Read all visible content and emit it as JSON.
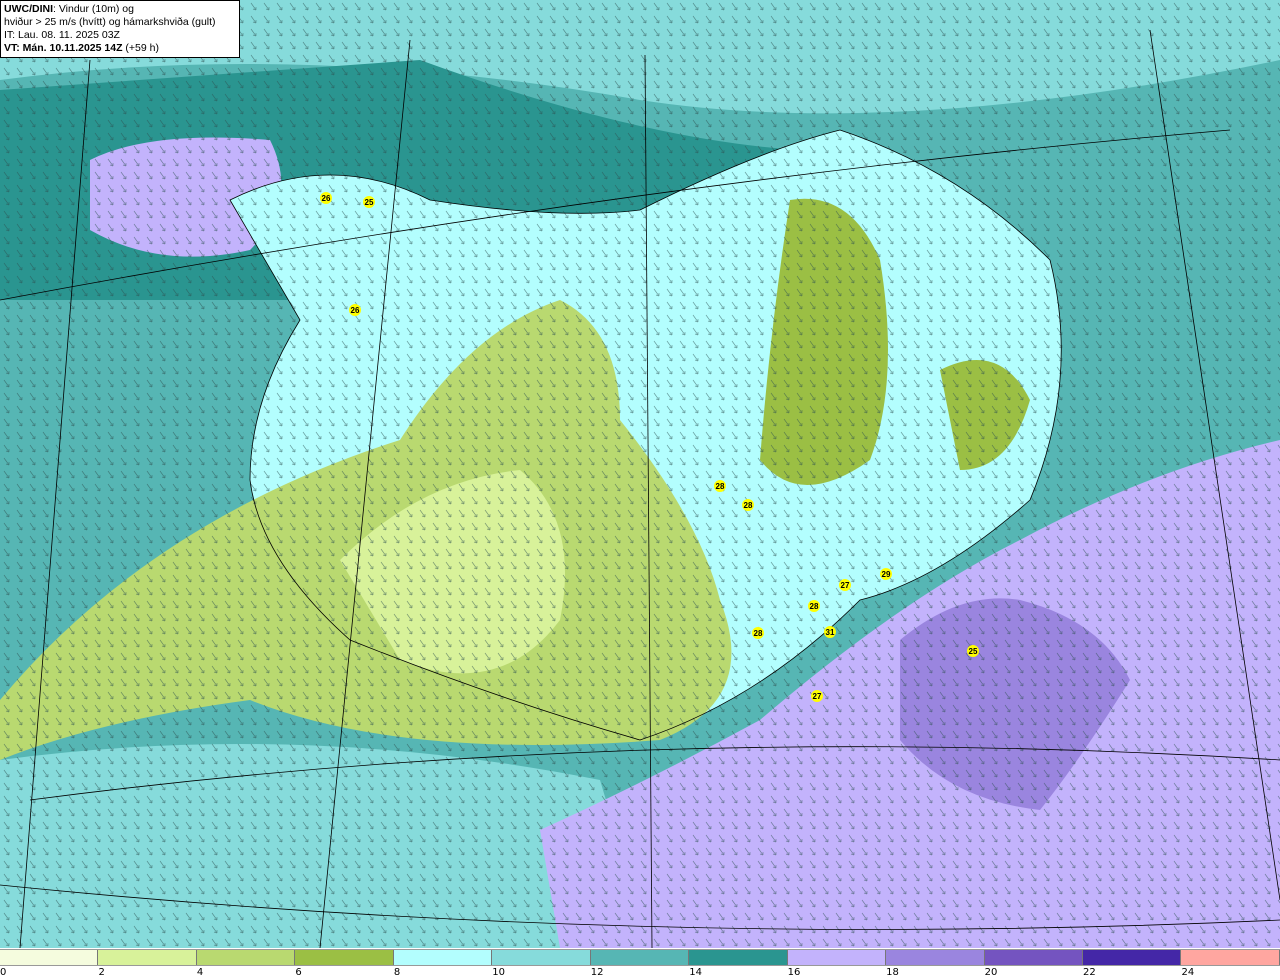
{
  "header": {
    "model": "UWC/DINI",
    "title_rest": ": Vindur (10m) og",
    "line2": "hviður > 25 m/s (hvítt) og hámarkshviða (gult)",
    "it_line": "IT: Lau. 08. 11. 2025 03Z",
    "vt_bold": "VT: Mán. 10.11.2025 14Z",
    "vt_rest": " (+59 h)"
  },
  "legend": {
    "ticks": [
      "0",
      "2",
      "4",
      "6",
      "8",
      "10",
      "12",
      "14",
      "16",
      "18",
      "20",
      "22",
      "24"
    ],
    "colors": [
      "#f5fcde",
      "#d8f29a",
      "#b9d970",
      "#9bbf44",
      "#b3fefe",
      "#86dbdb",
      "#56b6b4",
      "#2a9590",
      "#c3b3fc",
      "#9a85df",
      "#7454c0",
      "#4427a7",
      "#ffa6a0"
    ]
  },
  "map": {
    "sea_color": "#56b6b4",
    "gust_labels": [
      {
        "value": "26",
        "lon_lat_hint": "Vestfirðir"
      },
      {
        "value": "25",
        "lon_lat_hint": "Vestfirðir"
      },
      {
        "value": "26",
        "lon_lat_hint": "Vestfirðir"
      },
      {
        "value": "28",
        "lon_lat_hint": "Hálendi"
      },
      {
        "value": "28",
        "lon_lat_hint": "Hálendi"
      },
      {
        "value": "27",
        "lon_lat_hint": "Suðausturland"
      },
      {
        "value": "29",
        "lon_lat_hint": "Suðausturland"
      },
      {
        "value": "28",
        "lon_lat_hint": "Suðausturland"
      },
      {
        "value": "31",
        "lon_lat_hint": "Suðausturland"
      },
      {
        "value": "28",
        "lon_lat_hint": "Suðurland"
      },
      {
        "value": "25",
        "lon_lat_hint": "Hafið"
      },
      {
        "value": "27",
        "lon_lat_hint": "Hafið"
      }
    ]
  }
}
